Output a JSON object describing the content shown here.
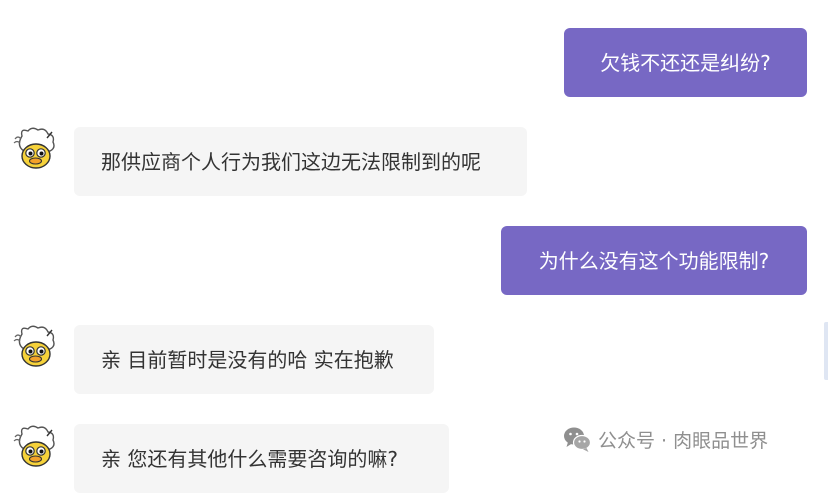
{
  "colors": {
    "user_bubble": "#7768c4",
    "agent_bubble": "#f5f5f5",
    "agent_text": "#333333",
    "watermark": "#8f8f8f"
  },
  "chat": {
    "messages": [
      {
        "sender": "user",
        "text": "欠钱不还还是纠纷?"
      },
      {
        "sender": "agent",
        "avatar_icon": "duck-avatar-icon",
        "text": "那供应商个人行为我们这边无法限制到的呢"
      },
      {
        "sender": "user",
        "text": "为什么没有这个功能限制?"
      },
      {
        "sender": "agent",
        "avatar_icon": "duck-avatar-icon",
        "text": "亲 目前暂时是没有的哈 实在抱歉"
      },
      {
        "sender": "agent",
        "avatar_icon": "duck-avatar-icon",
        "text": "亲 您还有其他什么需要咨询的嘛?"
      }
    ]
  },
  "watermark": {
    "icon": "wechat-icon",
    "text": "公众号 · 肉眼品世界"
  }
}
